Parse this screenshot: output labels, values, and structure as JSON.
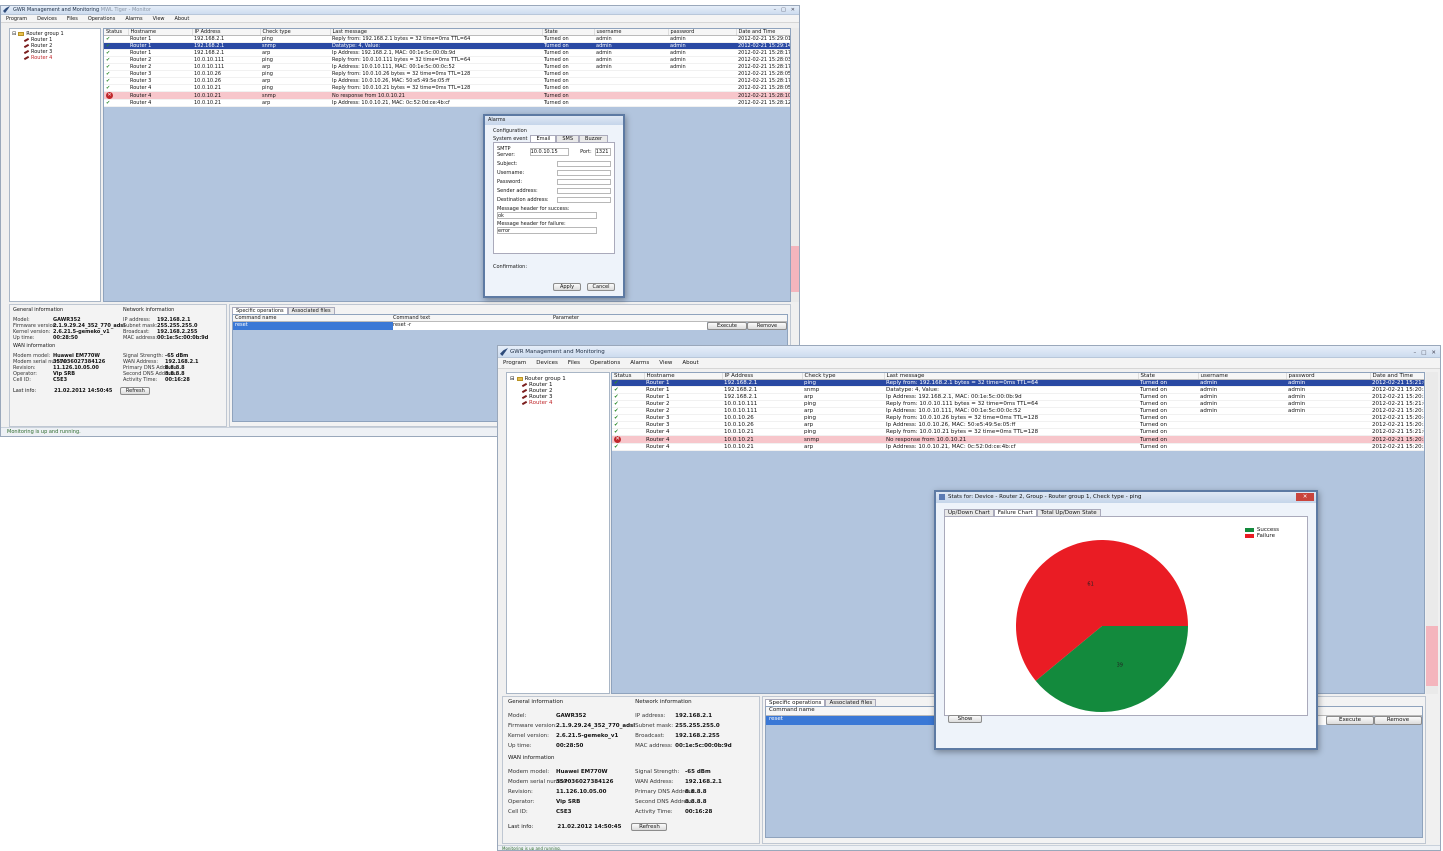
{
  "back": {
    "title": "GWR Management and Monitoring",
    "title_suffix": "MWL Tiger - Monitor",
    "menu": [
      "Program",
      "Devices",
      "Files",
      "Operations",
      "Alarms",
      "View",
      "About"
    ],
    "tree": {
      "root": "Router group 1",
      "children": [
        "Router 1",
        "Router 2",
        "Router 3",
        "Router 4"
      ]
    },
    "columns": [
      "Status",
      "Hostname",
      "IP Address",
      "Check type",
      "Last message",
      "State",
      "username",
      "password",
      "Date and Time"
    ],
    "rows": [
      {
        "status": "ok",
        "host": "Router 1",
        "ip": "192.168.2.1",
        "check": "ping",
        "msg": "Reply from: 192.168.2.1 bytes = 32 time=0ms TTL=64",
        "state": "Turned on",
        "user": "admin",
        "pass": "admin",
        "date": "2012-02-21 15:29:01",
        "cls": ""
      },
      {
        "status": "ok",
        "host": "Router 1",
        "ip": "192.168.2.1",
        "check": "snmp",
        "msg": "Datatype: 4, Value:",
        "state": "Turned on",
        "user": "admin",
        "pass": "admin",
        "date": "2012-02-21 15:29:14",
        "cls": "sel"
      },
      {
        "status": "ok",
        "host": "Router 1",
        "ip": "192.168.2.1",
        "check": "arp",
        "msg": "Ip Address: 192.168.2.1, MAC: 00:1e:5c:00:0b:9d",
        "state": "Turned on",
        "user": "admin",
        "pass": "admin",
        "date": "2012-02-21 15:28:17",
        "cls": ""
      },
      {
        "status": "ok",
        "host": "Router 2",
        "ip": "10.0.10.111",
        "check": "ping",
        "msg": "Reply from: 10.0.10.111 bytes = 32 time=0ms TTL=64",
        "state": "Turned on",
        "user": "admin",
        "pass": "admin",
        "date": "2012-02-21 15:28:03",
        "cls": ""
      },
      {
        "status": "ok",
        "host": "Router 2",
        "ip": "10.0.10.111",
        "check": "arp",
        "msg": "Ip Address: 10.0.10.111, MAC: 00:1e:5c:00:0c:52",
        "state": "Turned on",
        "user": "admin",
        "pass": "admin",
        "date": "2012-02-21 15:28:17",
        "cls": ""
      },
      {
        "status": "ok",
        "host": "Router 3",
        "ip": "10.0.10.26",
        "check": "ping",
        "msg": "Reply from: 10.0.10.26 bytes = 32 time=0ms TTL=128",
        "state": "Turned on",
        "user": "",
        "pass": "",
        "date": "2012-02-21 15:28:05",
        "cls": ""
      },
      {
        "status": "ok",
        "host": "Router 3",
        "ip": "10.0.10.26",
        "check": "arp",
        "msg": "Ip Address: 10.0.10.26, MAC: 50:e5:49:5e:05:ff",
        "state": "Turned on",
        "user": "",
        "pass": "",
        "date": "2012-02-21 15:28:17",
        "cls": ""
      },
      {
        "status": "ok",
        "host": "Router 4",
        "ip": "10.0.10.21",
        "check": "ping",
        "msg": "Reply from: 10.0.10.21 bytes = 32 time=0ms TTL=128",
        "state": "Turned on",
        "user": "",
        "pass": "",
        "date": "2012-02-21 15:28:05",
        "cls": ""
      },
      {
        "status": "err",
        "host": "Router 4",
        "ip": "10.0.10.21",
        "check": "snmp",
        "msg": "No response from 10.0.10.21",
        "state": "Turned on",
        "user": "",
        "pass": "",
        "date": "2012-02-21 15:28:10",
        "cls": "bad"
      },
      {
        "status": "ok",
        "host": "Router 4",
        "ip": "10.0.10.21",
        "check": "arp",
        "msg": "Ip Address: 10.0.10.21, MAC: 0c:52:0d:ce:4b:cf",
        "state": "Turned on",
        "user": "",
        "pass": "",
        "date": "2012-02-21 15:28:12",
        "cls": ""
      }
    ],
    "general_info": {
      "title": "General information",
      "items": [
        {
          "k": "Model:",
          "v": "GAWR352"
        },
        {
          "k": "Firmware version:",
          "v": "2.1.9.29.24_352_770_adsl"
        },
        {
          "k": "Kernel version:",
          "v": "2.6.21.5-gemeko_v1"
        },
        {
          "k": "Up time:",
          "v": "00:28:50"
        }
      ]
    },
    "network_info": {
      "title": "Network information",
      "items": [
        {
          "k": "IP address:",
          "v": "192.168.2.1"
        },
        {
          "k": "Subnet mask:",
          "v": "255.255.255.0"
        },
        {
          "k": "Broadcast:",
          "v": "192.168.2.255"
        },
        {
          "k": "MAC address:",
          "v": "00:1e:5c:00:0b:9d"
        }
      ]
    },
    "wan_info": {
      "title": "WAN information",
      "left": [
        {
          "k": "Modem model:",
          "v": "Huawei EM770W"
        },
        {
          "k": "Modem serial number:",
          "v": "357036027384126"
        },
        {
          "k": "Revision:",
          "v": "11.126.10.05.00"
        },
        {
          "k": "Operator:",
          "v": "Vip SRB"
        },
        {
          "k": "Cell ID:",
          "v": "C5E3"
        }
      ],
      "right": [
        {
          "k": "Signal Strength:",
          "v": "-65 dBm"
        },
        {
          "k": "WAN Address:",
          "v": "192.168.2.1"
        },
        {
          "k": "Primary DNS Address:",
          "v": "8.8.8.8"
        },
        {
          "k": "Second DNS Address:",
          "v": "8.8.8.8"
        },
        {
          "k": "Activity Time:",
          "v": "00:16:28"
        }
      ],
      "last_info_label": "Last info:",
      "last_info_value": "21.02.2012 14:50:45",
      "refresh": "Refresh"
    },
    "ops": {
      "tabs": [
        "Specific operations",
        "Associated files"
      ],
      "columns": [
        "Command name",
        "Command text",
        "Parameter"
      ],
      "row": {
        "name": "reset",
        "text": "reset -r",
        "param": ""
      },
      "execute": "Execute",
      "remove": "Remove"
    },
    "status": "Monitoring is up and running.",
    "alarms": {
      "title": "Alarms",
      "group": "Configuration",
      "system_event": "System event",
      "tabs": [
        "Email",
        "SMS",
        "Buzzer"
      ],
      "smtp_label": "SMTP Server:",
      "smtp_value": "10.0.10.15",
      "port_label": "Port:",
      "port_value": "1321",
      "fields": [
        "Subject:",
        "Username:",
        "Password:",
        "Sender address:",
        "Destination address:"
      ],
      "msg_success_label": "Message header for success:",
      "msg_success_value": "ok",
      "msg_failure_label": "Message header for failure:",
      "msg_failure_value": "error",
      "confirm_label": "Confirmation:",
      "apply": "Apply",
      "cancel": "Cancel"
    }
  },
  "front": {
    "title": "GWR Management and Monitoring",
    "menu": [
      "Program",
      "Devices",
      "Files",
      "Operations",
      "Alarms",
      "View",
      "About"
    ],
    "tree": {
      "root": "Router group 1",
      "children": [
        "Router 1",
        "Router 2",
        "Router 3",
        "Router 4"
      ]
    },
    "columns": [
      "Status",
      "Hostname",
      "IP Address",
      "Check type",
      "Last message",
      "State",
      "username",
      "password",
      "Date and Time"
    ],
    "rows": [
      {
        "status": "ok",
        "host": "Router 1",
        "ip": "192.168.2.1",
        "check": "ping",
        "msg": "Reply from: 192.168.2.1 bytes = 32 time=0ms TTL=64",
        "state": "Turned on",
        "user": "admin",
        "pass": "admin",
        "date": "2012-02-21 15:21:02",
        "cls": "sel"
      },
      {
        "status": "ok",
        "host": "Router 1",
        "ip": "192.168.2.1",
        "check": "snmp",
        "msg": "Datatype: 4, Value:",
        "state": "Turned on",
        "user": "admin",
        "pass": "admin",
        "date": "2012-02-21 15:20:59",
        "cls": ""
      },
      {
        "status": "ok",
        "host": "Router 1",
        "ip": "192.168.2.1",
        "check": "arp",
        "msg": "Ip Address: 192.168.2.1, MAC: 00:1e:5c:00:0b:9d",
        "state": "Turned on",
        "user": "admin",
        "pass": "admin",
        "date": "2012-02-21 15:20:58",
        "cls": ""
      },
      {
        "status": "ok",
        "host": "Router 2",
        "ip": "10.0.10.111",
        "check": "ping",
        "msg": "Reply from: 10.0.10.111 bytes = 32 time=0ms TTL=64",
        "state": "Turned on",
        "user": "admin",
        "pass": "admin",
        "date": "2012-02-21 15:21:02",
        "cls": ""
      },
      {
        "status": "ok",
        "host": "Router 2",
        "ip": "10.0.10.111",
        "check": "arp",
        "msg": "Ip Address: 10.0.10.111, MAC: 00:1e:5c:00:0c:52",
        "state": "Turned on",
        "user": "admin",
        "pass": "admin",
        "date": "2012-02-21 15:20:59",
        "cls": ""
      },
      {
        "status": "ok",
        "host": "Router 3",
        "ip": "10.0.10.26",
        "check": "ping",
        "msg": "Reply from: 10.0.10.26 bytes = 32 time=0ms TTL=128",
        "state": "Turned on",
        "user": "",
        "pass": "",
        "date": "2012-02-21 15:20:48",
        "cls": ""
      },
      {
        "status": "ok",
        "host": "Router 3",
        "ip": "10.0.10.26",
        "check": "arp",
        "msg": "Ip Address: 10.0.10.26, MAC: 50:e5:49:5e:05:ff",
        "state": "Turned on",
        "user": "",
        "pass": "",
        "date": "2012-02-21 15:20:59",
        "cls": ""
      },
      {
        "status": "ok",
        "host": "Router 4",
        "ip": "10.0.10.21",
        "check": "ping",
        "msg": "Reply from: 10.0.10.21 bytes = 32 time=0ms TTL=128",
        "state": "Turned on",
        "user": "",
        "pass": "",
        "date": "2012-02-21 15:21:02",
        "cls": ""
      },
      {
        "status": "err",
        "host": "Router 4",
        "ip": "10.0.10.21",
        "check": "snmp",
        "msg": "No response from 10.0.10.21",
        "state": "Turned on",
        "user": "",
        "pass": "",
        "date": "2012-02-21 15:20:59",
        "cls": "bad"
      },
      {
        "status": "ok",
        "host": "Router 4",
        "ip": "10.0.10.21",
        "check": "arp",
        "msg": "Ip Address: 10.0.10.21, MAC: 0c:52:0d:ce:4b:cf",
        "state": "Turned on",
        "user": "",
        "pass": "",
        "date": "2012-02-21 15:20:58",
        "cls": ""
      }
    ],
    "general_info": {
      "title": "General information",
      "items": [
        {
          "k": "Model:",
          "v": "GAWR352"
        },
        {
          "k": "Firmware version:",
          "v": "2.1.9.29.24_352_770_adsl"
        },
        {
          "k": "Kernel version:",
          "v": "2.6.21.5-gemeko_v1"
        },
        {
          "k": "Up time:",
          "v": "00:28:50"
        }
      ]
    },
    "network_info": {
      "title": "Network information",
      "items": [
        {
          "k": "IP address:",
          "v": "192.168.2.1"
        },
        {
          "k": "Subnet mask:",
          "v": "255.255.255.0"
        },
        {
          "k": "Broadcast:",
          "v": "192.168.2.255"
        },
        {
          "k": "MAC address:",
          "v": "00:1e:5c:00:0b:9d"
        }
      ]
    },
    "wan_info": {
      "title": "WAN information",
      "left": [
        {
          "k": "Modem model:",
          "v": "Huawei EM770W"
        },
        {
          "k": "Modem serial number:",
          "v": "357036027384126"
        },
        {
          "k": "Revision:",
          "v": "11.126.10.05.00"
        },
        {
          "k": "Operator:",
          "v": "Vip SRB"
        },
        {
          "k": "Cell ID:",
          "v": "C5E3"
        }
      ],
      "right": [
        {
          "k": "Signal Strength:",
          "v": "-65 dBm"
        },
        {
          "k": "WAN Address:",
          "v": "192.168.2.1"
        },
        {
          "k": "Primary DNS Address:",
          "v": "8.8.8.8"
        },
        {
          "k": "Second DNS Address:",
          "v": "8.8.8.8"
        },
        {
          "k": "Activity Time:",
          "v": "00:16:28"
        }
      ],
      "last_info_label": "Last info:",
      "last_info_value": "21.02.2012 14:50:45",
      "refresh": "Refresh"
    },
    "ops": {
      "tabs": [
        "Specific operations",
        "Associated files"
      ],
      "columns": [
        "Command name"
      ],
      "row": {
        "name": "reset"
      },
      "execute": "Execute",
      "remove": "Remove"
    },
    "status": "Monitoring is up and running.",
    "stats": {
      "title": "Stats for: Device - Router 2, Group - Router group 1, Check type - ping",
      "tabs": [
        "Up/Down Chart",
        "Failure Chart",
        "Total Up/Down State"
      ],
      "show": "Show",
      "legend": [
        {
          "name": "Success",
          "color": "#138a3d"
        },
        {
          "name": "Failure",
          "color": "#ea1c24"
        }
      ]
    }
  },
  "chart_data": {
    "type": "pie",
    "slices": [
      {
        "name": "Success",
        "value": 39,
        "color": "#138a3d"
      },
      {
        "name": "Failure",
        "value": 61,
        "color": "#ea1c24"
      }
    ],
    "labels": [
      "61",
      "39"
    ],
    "legend_position": "top-right"
  }
}
